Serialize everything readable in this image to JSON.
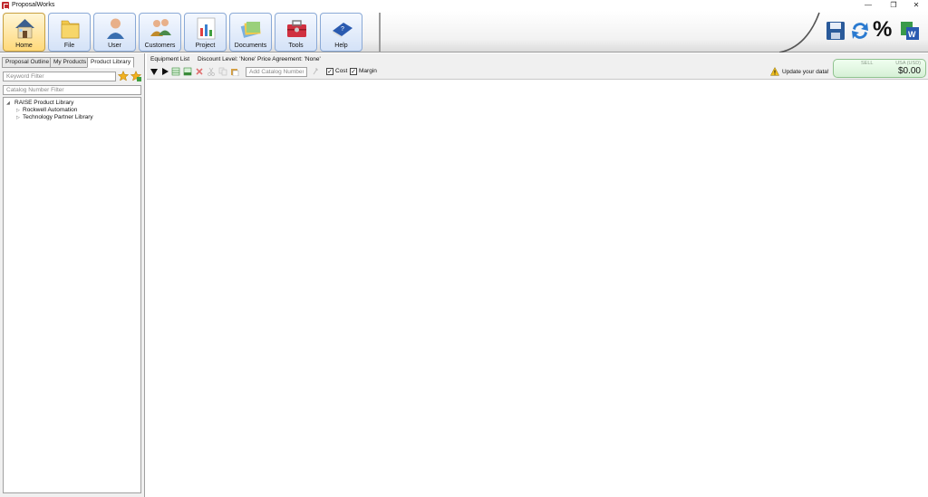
{
  "app": {
    "title": "ProposalWorks"
  },
  "window_controls": {
    "minimize": "—",
    "restore": "❐",
    "close": "✕"
  },
  "ribbon": {
    "buttons": [
      {
        "label": "Home",
        "icon": "house-icon",
        "active": true
      },
      {
        "label": "File",
        "icon": "folder-icon"
      },
      {
        "label": "User",
        "icon": "user-icon"
      },
      {
        "label": "Customers",
        "icon": "customers-icon"
      },
      {
        "label": "Project",
        "icon": "bar-chart-icon"
      },
      {
        "label": "Documents",
        "icon": "documents-icon"
      },
      {
        "label": "Tools",
        "icon": "toolbox-icon"
      },
      {
        "label": "Help",
        "icon": "help-book-icon"
      }
    ],
    "quick_actions": [
      "save-icon",
      "sync-icon",
      "percent-icon",
      "word-export-icon"
    ],
    "percent_glyph": "%"
  },
  "left_panel": {
    "tabs": [
      "Proposal Outline",
      "My Products",
      "Product Library"
    ],
    "active_tab": "Product Library",
    "keyword_placeholder": "Keyword Filter",
    "catalog_placeholder": "Catalog Number Filter",
    "tree": {
      "root": "RAISE Product Library",
      "children": [
        "Rockwell Automation",
        "Technology Partner Library"
      ]
    }
  },
  "main": {
    "equipment_list": "Equipment List",
    "discount_level": "Discount Level: 'None'",
    "price_agreement": "Price Agreement: 'None'",
    "add_catalog_placeholder": "Add Catalog Number",
    "cost_label": "Cost",
    "margin_label": "Margin",
    "cost_checked": true,
    "margin_checked": true,
    "check_mark": "✓",
    "update_notice": "Update your data!",
    "price": {
      "sell_label": "SELL",
      "currency": "USA (USD)",
      "value": "$0.00"
    }
  },
  "colors": {
    "accent_blue": "#8aa9d6",
    "home_active": "#ffd97a",
    "price_green": "#d6f0d6"
  }
}
